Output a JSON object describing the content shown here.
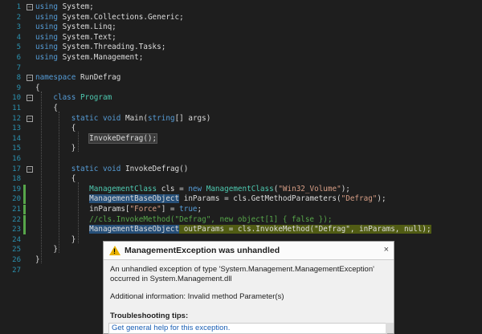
{
  "lines": [
    {
      "n": "1",
      "t": [
        [
          "using",
          "kw"
        ],
        [
          " System;",
          ""
        ]
      ]
    },
    {
      "n": "2",
      "t": [
        [
          "using",
          "kw"
        ],
        [
          " System.Collections.Generic;",
          ""
        ]
      ]
    },
    {
      "n": "3",
      "t": [
        [
          "using",
          "kw"
        ],
        [
          " System.Linq;",
          ""
        ]
      ]
    },
    {
      "n": "4",
      "t": [
        [
          "using",
          "kw"
        ],
        [
          " System.Text;",
          ""
        ]
      ]
    },
    {
      "n": "5",
      "t": [
        [
          "using",
          "kw"
        ],
        [
          " System.Threading.Tasks;",
          ""
        ]
      ]
    },
    {
      "n": "6",
      "t": [
        [
          "using",
          "kw"
        ],
        [
          " System.Management;",
          ""
        ]
      ]
    },
    {
      "n": "7",
      "t": []
    },
    {
      "n": "8",
      "t": [
        [
          "namespace",
          "kw"
        ],
        [
          " RunDefrag",
          ""
        ]
      ]
    },
    {
      "n": "9",
      "t": [
        [
          "{",
          ""
        ]
      ]
    },
    {
      "n": "10",
      "t": [
        [
          "    ",
          ""
        ],
        [
          "class",
          "kw"
        ],
        [
          " ",
          ""
        ],
        [
          "Program",
          "ty"
        ]
      ]
    },
    {
      "n": "11",
      "t": [
        [
          "    {",
          ""
        ]
      ]
    },
    {
      "n": "12",
      "t": [
        [
          "        ",
          ""
        ],
        [
          "static",
          "kw"
        ],
        [
          " ",
          ""
        ],
        [
          "void",
          "kw"
        ],
        [
          " Main(",
          ""
        ],
        [
          "string",
          "kw"
        ],
        [
          "[] args)",
          ""
        ]
      ]
    },
    {
      "n": "13",
      "t": [
        [
          "        {",
          ""
        ]
      ]
    },
    {
      "n": "14",
      "t": [
        [
          "            ",
          ""
        ],
        [
          "InvokeDefrag();",
          "hlo"
        ]
      ]
    },
    {
      "n": "15",
      "t": [
        [
          "        }",
          ""
        ]
      ]
    },
    {
      "n": "16",
      "t": []
    },
    {
      "n": "17",
      "t": [
        [
          "        ",
          ""
        ],
        [
          "static",
          "kw"
        ],
        [
          " ",
          ""
        ],
        [
          "void",
          "kw"
        ],
        [
          " InvokeDefrag()",
          ""
        ]
      ]
    },
    {
      "n": "18",
      "t": [
        [
          "        {",
          ""
        ]
      ]
    },
    {
      "n": "19",
      "t": [
        [
          "            ",
          ""
        ],
        [
          "ManagementClass",
          "ty"
        ],
        [
          " cls = ",
          ""
        ],
        [
          "new",
          "kw"
        ],
        [
          " ",
          ""
        ],
        [
          "ManagementClass",
          "ty"
        ],
        [
          "(",
          ""
        ],
        [
          "\"Win32_Volume\"",
          "st"
        ],
        [
          ");",
          ""
        ]
      ]
    },
    {
      "n": "20",
      "t": [
        [
          "            ",
          ""
        ],
        [
          "ManagementBaseObject",
          "hl"
        ],
        [
          " inParams = cls.GetMethodParameters(",
          ""
        ],
        [
          "\"Defrag\"",
          "st"
        ],
        [
          ");",
          ""
        ]
      ]
    },
    {
      "n": "21",
      "t": [
        [
          "            inParams[",
          ""
        ],
        [
          "\"Force\"",
          "st"
        ],
        [
          "] = ",
          ""
        ],
        [
          "true",
          "kw"
        ],
        [
          ";",
          ""
        ]
      ]
    },
    {
      "n": "22",
      "t": [
        [
          "            ",
          ""
        ],
        [
          "//cls.InvokeMethod(\"Defrag\", new object[1] { false });",
          "cm"
        ]
      ]
    },
    {
      "n": "23",
      "t": [
        [
          "            ",
          ""
        ],
        [
          "ManagementBaseObject",
          "hl"
        ],
        [
          " outParams = cls.InvokeMethod(\"Defrag\", inParams, null);",
          "cur"
        ]
      ]
    },
    {
      "n": "24",
      "t": [
        [
          "        }",
          ""
        ]
      ]
    },
    {
      "n": "25",
      "t": [
        [
          "    }",
          ""
        ]
      ]
    },
    {
      "n": "26",
      "t": [
        [
          "}",
          ""
        ]
      ]
    },
    {
      "n": "27",
      "t": []
    }
  ],
  "popup": {
    "title": "ManagementException was unhandled",
    "message": "An unhandled exception of type 'System.Management.ManagementException' occurred in System.Management.dll",
    "additional": "Additional information: Invalid method Parameter(s)",
    "tips_heading": "Troubleshooting tips:",
    "tip_link": "Get general help for this exception.",
    "close": "×",
    "warn_glyph": "!"
  },
  "colors": {
    "keyword": "#569cd6",
    "type": "#4ec9b0",
    "string": "#d69d85",
    "comment": "#57a64a",
    "line_number": "#2b91af"
  }
}
